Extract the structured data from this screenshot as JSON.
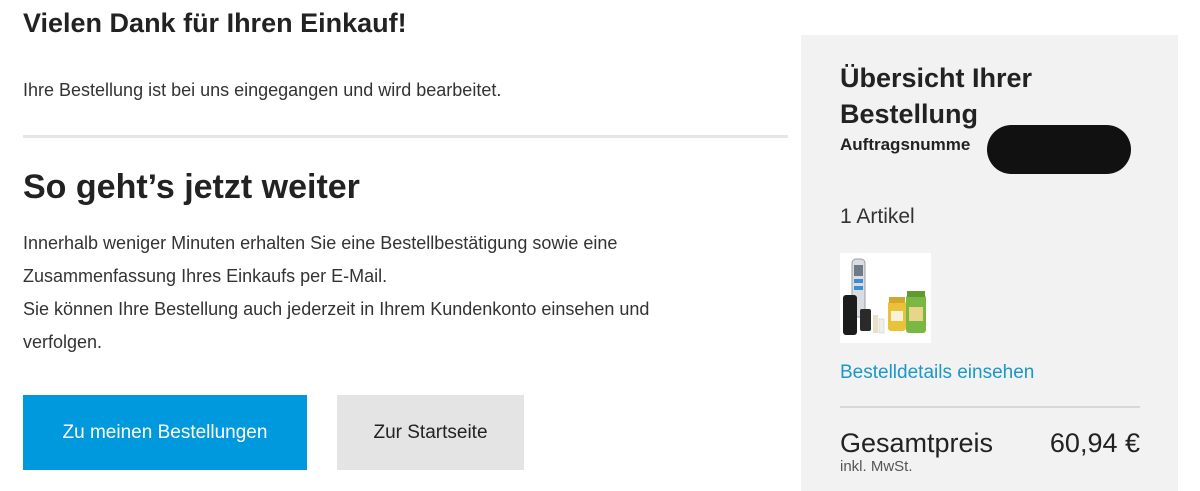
{
  "confirmation": {
    "thanks_title": "Vielen Dank für Ihren Einkauf!",
    "received_text": "Ihre Bestellung ist bei uns eingegangen und wird bearbeitet."
  },
  "next_steps": {
    "title": "So geht’s jetzt weiter",
    "lines": [
      "Innerhalb weniger Minuten erhalten Sie eine Bestellbestätigung sowie eine",
      "Zusammenfassung Ihres Einkaufs per E-Mail.",
      "Sie können Ihre Bestellung auch jederzeit in Ihrem Kundenkonto einsehen und",
      "verfolgen."
    ]
  },
  "buttons": {
    "orders_label": "Zu meinen Bestellungen",
    "home_label": "Zur Startseite"
  },
  "summary": {
    "title": "Übersicht Ihrer Bestellung",
    "order_number_label": "Auftragsnumme",
    "item_count": "1 Artikel",
    "details_link": "Bestelldetails einsehen",
    "total_label": "Gesamtpreis",
    "total_value": "60,94 €",
    "tax_note": "inkl. MwSt."
  },
  "colors": {
    "primary_button": "#0099dd",
    "secondary_button": "#e4e4e4",
    "link": "#1a98c7",
    "panel_background": "#f2f2f2"
  }
}
